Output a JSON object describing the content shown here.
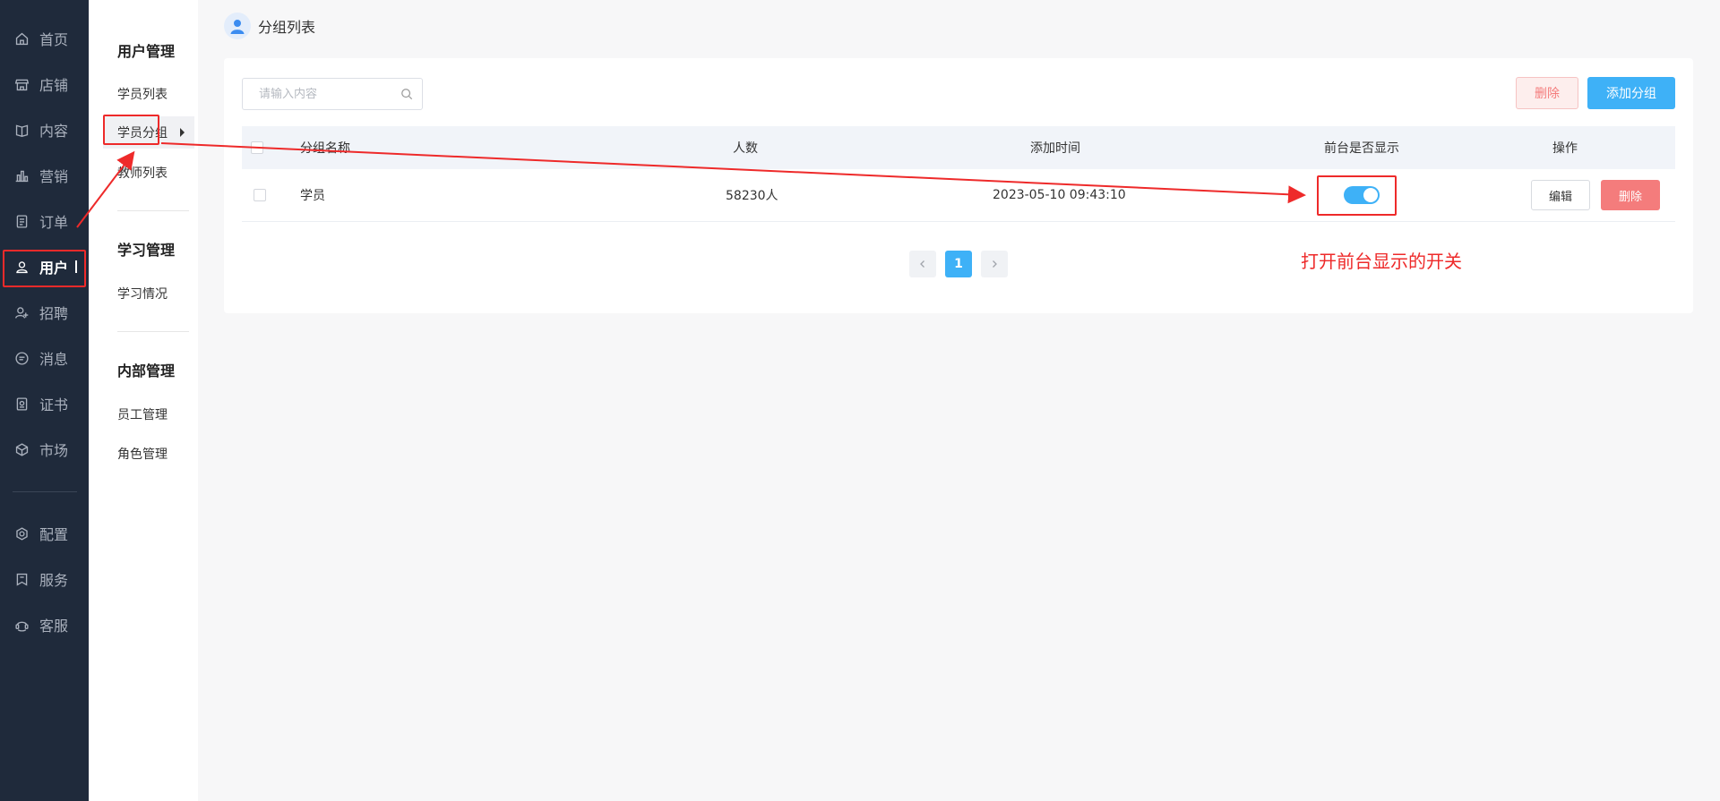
{
  "nav": {
    "items": [
      {
        "label": "首页",
        "icon": "home-icon"
      },
      {
        "label": "店铺",
        "icon": "store-icon"
      },
      {
        "label": "内容",
        "icon": "book-icon"
      },
      {
        "label": "营销",
        "icon": "chart-icon"
      },
      {
        "label": "订单",
        "icon": "order-icon"
      },
      {
        "label": "用户",
        "icon": "user-icon",
        "active": true
      },
      {
        "label": "招聘",
        "icon": "recruit-icon"
      },
      {
        "label": "消息",
        "icon": "message-icon"
      },
      {
        "label": "证书",
        "icon": "certificate-icon"
      },
      {
        "label": "市场",
        "icon": "market-icon"
      },
      {
        "label": "配置",
        "icon": "gear-icon"
      },
      {
        "label": "服务",
        "icon": "service-icon"
      },
      {
        "label": "客服",
        "icon": "support-icon"
      }
    ]
  },
  "submenu": {
    "group1": {
      "title": "用户管理",
      "items": [
        "学员列表",
        "学员分组",
        "教师列表"
      ]
    },
    "group2": {
      "title": "学习管理",
      "items": [
        "学习情况"
      ]
    },
    "group3": {
      "title": "内部管理",
      "items": [
        "员工管理",
        "角色管理"
      ]
    }
  },
  "header": {
    "title": "分组列表"
  },
  "toolbar": {
    "search_placeholder": "请输入内容",
    "delete_label": "删除",
    "add_label": "添加分组"
  },
  "table": {
    "columns": [
      "分组名称",
      "人数",
      "添加时间",
      "前台是否显示",
      "操作"
    ],
    "rows": [
      {
        "name": "学员",
        "count": "58230人",
        "time": "2023-05-10 09:43:10",
        "visible": true,
        "edit": "编辑",
        "delete": "删除"
      }
    ]
  },
  "pagination": {
    "current": "1"
  },
  "annotation": {
    "text": "打开前台显示的开关"
  },
  "colors": {
    "nav_bg": "#1f2a3b",
    "accent": "#3eb1f7",
    "danger": "#f47c7c",
    "annotation": "#ee2a2a"
  }
}
